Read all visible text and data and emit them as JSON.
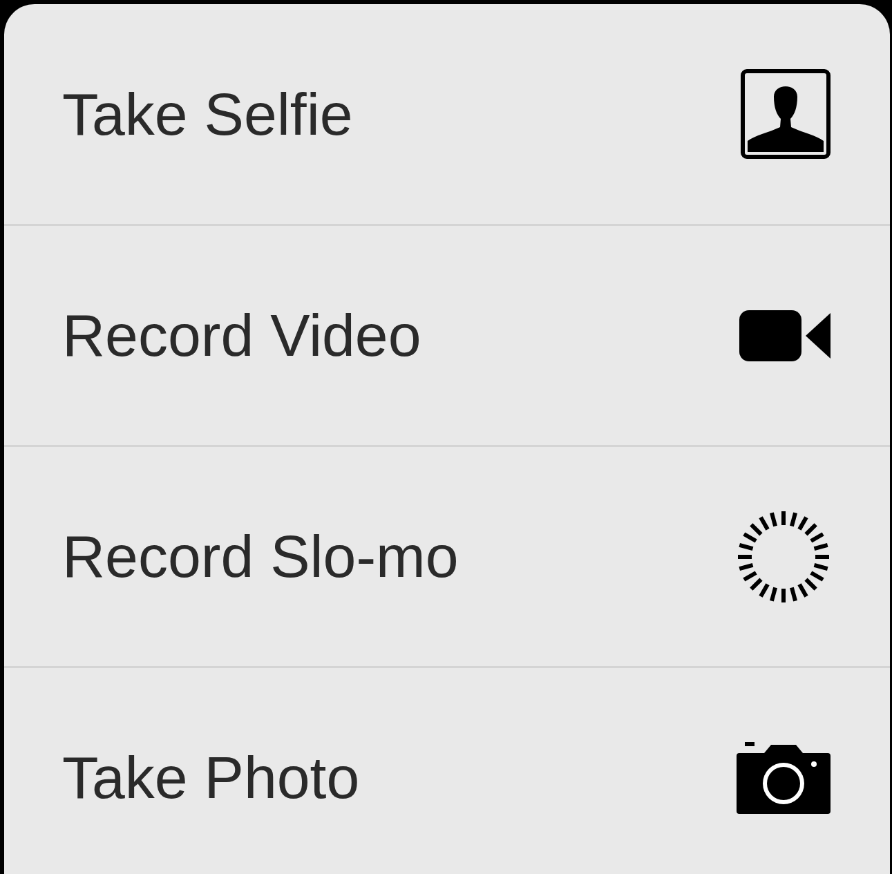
{
  "menu": {
    "items": [
      {
        "label": "Take Selfie",
        "kind": "selfie"
      },
      {
        "label": "Record Video",
        "kind": "video"
      },
      {
        "label": "Record Slo-mo",
        "kind": "slomo"
      },
      {
        "label": "Take Photo",
        "kind": "photo"
      }
    ]
  }
}
